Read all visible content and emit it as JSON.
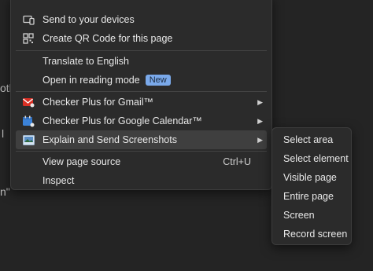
{
  "background": {
    "fragments": [
      "oth",
      "l",
      "n\""
    ]
  },
  "context_menu": {
    "items": [
      {
        "label": "Send to your devices",
        "icon": "devices-icon"
      },
      {
        "label": "Create QR Code for this page",
        "icon": "qr-code-icon"
      },
      {
        "label": "Translate to English"
      },
      {
        "label": "Open in reading mode",
        "badge": "New"
      },
      {
        "label": "Checker Plus for Gmail™",
        "icon": "gmail-checker-icon",
        "arrow": "▶"
      },
      {
        "label": "Checker Plus for Google Calendar™",
        "icon": "calendar-checker-icon",
        "arrow": "▶"
      },
      {
        "label": "Explain and Send Screenshots",
        "icon": "screenshot-icon",
        "arrow": "▶"
      },
      {
        "label": "View page source",
        "shortcut": "Ctrl+U"
      },
      {
        "label": "Inspect"
      }
    ]
  },
  "submenu": {
    "items": [
      "Select area",
      "Select element",
      "Visible page",
      "Entire page",
      "Screen",
      "Record screen"
    ]
  },
  "colors": {
    "menu_bg": "#2b2b2b",
    "highlight": "#3f3f3f",
    "badge": "#7aa9ea",
    "gmail_red": "#d93025",
    "calendar_blue": "#3b82d8"
  }
}
